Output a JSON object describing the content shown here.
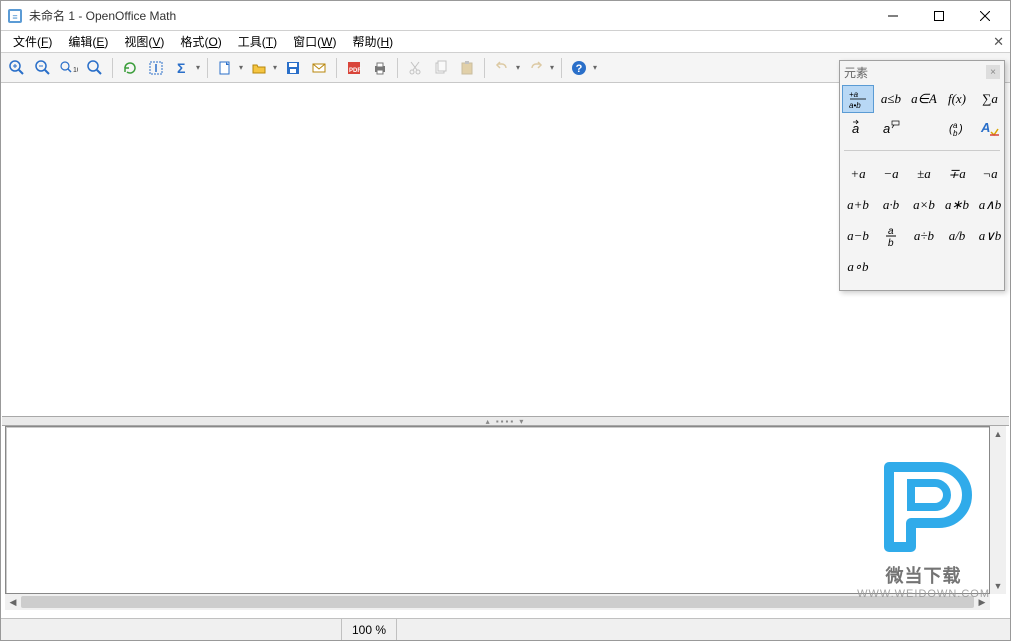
{
  "titlebar": {
    "title": "未命名 1 - OpenOffice Math"
  },
  "menu": {
    "file": {
      "label": "文件",
      "accel": "F"
    },
    "edit": {
      "label": "编辑",
      "accel": "E"
    },
    "view": {
      "label": "视图",
      "accel": "V"
    },
    "format": {
      "label": "格式",
      "accel": "O"
    },
    "tools": {
      "label": "工具",
      "accel": "T"
    },
    "window": {
      "label": "窗口",
      "accel": "W"
    },
    "help": {
      "label": "帮助",
      "accel": "H"
    }
  },
  "elements": {
    "title": "元素",
    "categories": [
      "+a⁄a•b",
      "a≤b",
      "a∈A",
      "f(x)",
      "∑a",
      "a⃗",
      "aᵀ",
      "",
      "(a b)",
      "A▦"
    ],
    "ops": [
      "+a",
      "−a",
      "±a",
      "∓a",
      "¬a",
      "a+b",
      "a·b",
      "a×b",
      "a∗b",
      "a∧b",
      "a−b",
      "a/b",
      "a÷b",
      "a/b",
      "a∨b",
      "a∘b"
    ]
  },
  "status": {
    "zoom": "100 %"
  },
  "watermark": {
    "text": "微当下载",
    "url": "WWW.WEIDOWN.COM"
  }
}
